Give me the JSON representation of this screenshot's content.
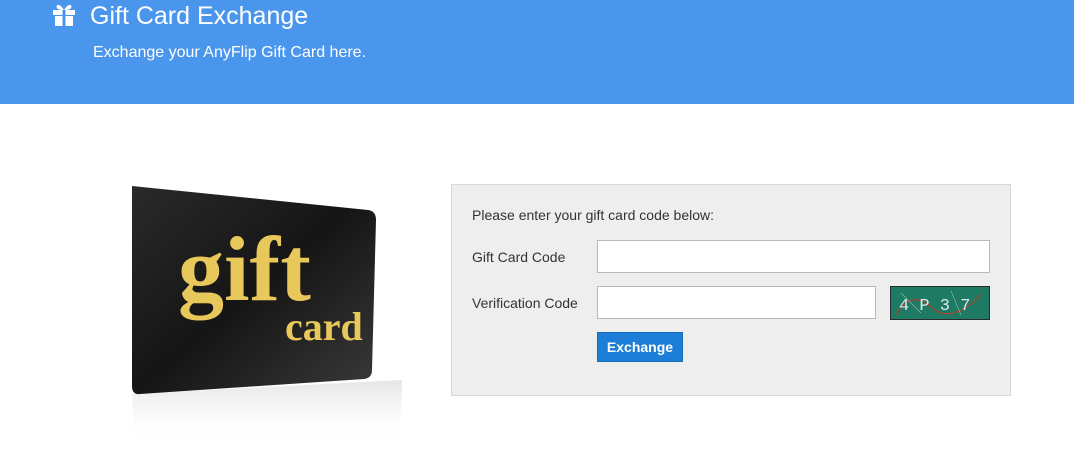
{
  "header": {
    "title": "Gift Card Exchange",
    "subtitle": "Exchange your AnyFlip Gift Card here.",
    "icon": "gift-icon",
    "background_color": "#4a96ec"
  },
  "card_image": {
    "text_large": "gift",
    "text_small": "card"
  },
  "form": {
    "intro": "Please enter your gift card code below:",
    "gift_card_code_label": "Gift Card Code",
    "gift_card_code_value": "",
    "verification_code_label": "Verification Code",
    "verification_code_value": "",
    "captcha_text": "4 P 3 7",
    "exchange_button_label": "Exchange",
    "button_color": "#1c7ed6"
  }
}
